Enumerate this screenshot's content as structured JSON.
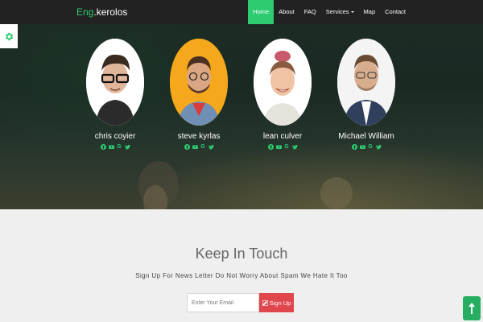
{
  "brand": {
    "accent": "Eng",
    "rest": ".kerolos"
  },
  "nav": {
    "items": [
      {
        "label": "Home",
        "active": true
      },
      {
        "label": "About",
        "active": false
      },
      {
        "label": "FAQ",
        "active": false
      },
      {
        "label": "Services",
        "active": false,
        "dropdown": true
      },
      {
        "label": "Map",
        "active": false
      },
      {
        "label": "Contact",
        "active": false
      }
    ]
  },
  "settings": {
    "icon": "gear-icon"
  },
  "team": {
    "members": [
      {
        "name": "chris coyier",
        "avatar_bg": "#ffffff"
      },
      {
        "name": "steve kyrlas",
        "avatar_bg": "#f5a81c"
      },
      {
        "name": "lean culver",
        "avatar_bg": "#ffffff"
      },
      {
        "name": "Michael William",
        "avatar_bg": "#ffffff"
      }
    ],
    "social_icons": [
      "facebook-icon",
      "youtube-icon",
      "google-icon",
      "twitter-icon"
    ]
  },
  "contact": {
    "title": "Keep In Touch",
    "subtitle": "Sign Up For News Letter Do Not Worry About Spam We Hate It Too",
    "email_placeholder": "Enter Your Email",
    "email_value": "",
    "signup_label": "Sign Up"
  },
  "scroll_top": {
    "icon": "arrow-up-icon"
  },
  "colors": {
    "accent": "#2ecc71",
    "navbar": "#222222",
    "signup": "#e0474c",
    "scroll_top": "#27ae60"
  }
}
